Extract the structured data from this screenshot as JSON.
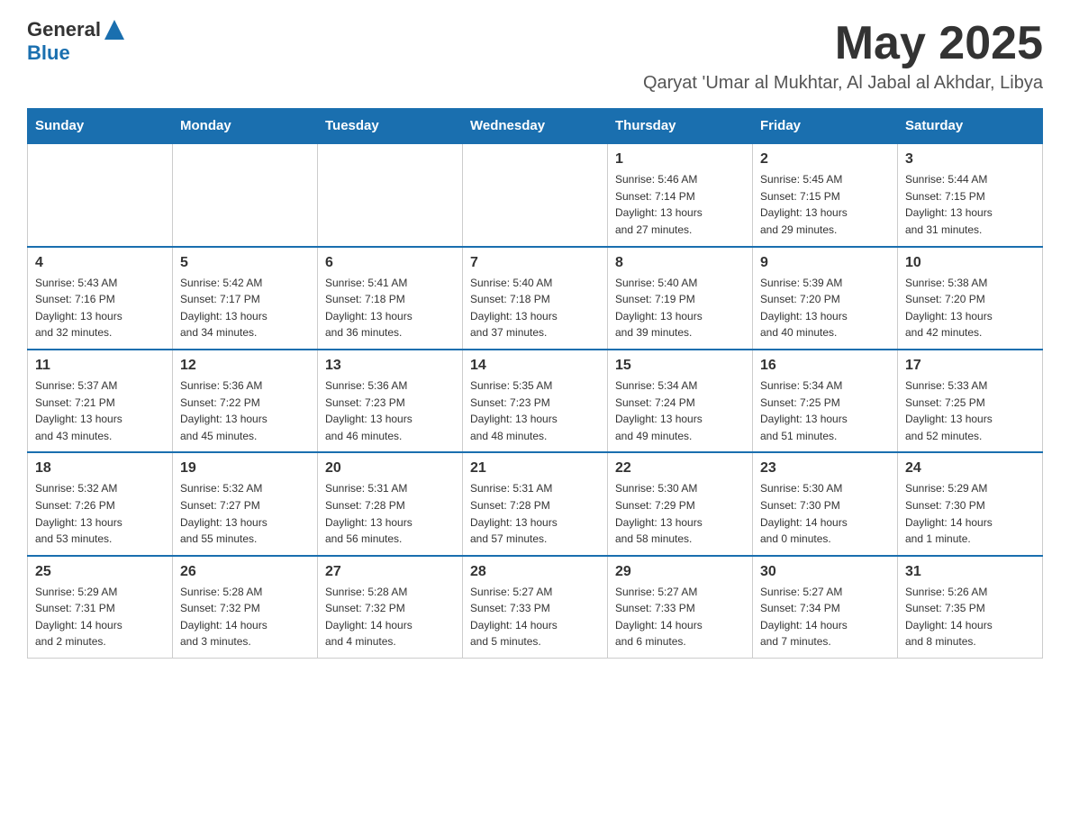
{
  "header": {
    "logo": {
      "text1": "General",
      "text2": "Blue"
    },
    "month": "May 2025",
    "location": "Qaryat 'Umar al Mukhtar, Al Jabal al Akhdar, Libya"
  },
  "days_of_week": [
    "Sunday",
    "Monday",
    "Tuesday",
    "Wednesday",
    "Thursday",
    "Friday",
    "Saturday"
  ],
  "weeks": [
    {
      "days": [
        {
          "number": "",
          "info": ""
        },
        {
          "number": "",
          "info": ""
        },
        {
          "number": "",
          "info": ""
        },
        {
          "number": "",
          "info": ""
        },
        {
          "number": "1",
          "info": "Sunrise: 5:46 AM\nSunset: 7:14 PM\nDaylight: 13 hours\nand 27 minutes."
        },
        {
          "number": "2",
          "info": "Sunrise: 5:45 AM\nSunset: 7:15 PM\nDaylight: 13 hours\nand 29 minutes."
        },
        {
          "number": "3",
          "info": "Sunrise: 5:44 AM\nSunset: 7:15 PM\nDaylight: 13 hours\nand 31 minutes."
        }
      ]
    },
    {
      "days": [
        {
          "number": "4",
          "info": "Sunrise: 5:43 AM\nSunset: 7:16 PM\nDaylight: 13 hours\nand 32 minutes."
        },
        {
          "number": "5",
          "info": "Sunrise: 5:42 AM\nSunset: 7:17 PM\nDaylight: 13 hours\nand 34 minutes."
        },
        {
          "number": "6",
          "info": "Sunrise: 5:41 AM\nSunset: 7:18 PM\nDaylight: 13 hours\nand 36 minutes."
        },
        {
          "number": "7",
          "info": "Sunrise: 5:40 AM\nSunset: 7:18 PM\nDaylight: 13 hours\nand 37 minutes."
        },
        {
          "number": "8",
          "info": "Sunrise: 5:40 AM\nSunset: 7:19 PM\nDaylight: 13 hours\nand 39 minutes."
        },
        {
          "number": "9",
          "info": "Sunrise: 5:39 AM\nSunset: 7:20 PM\nDaylight: 13 hours\nand 40 minutes."
        },
        {
          "number": "10",
          "info": "Sunrise: 5:38 AM\nSunset: 7:20 PM\nDaylight: 13 hours\nand 42 minutes."
        }
      ]
    },
    {
      "days": [
        {
          "number": "11",
          "info": "Sunrise: 5:37 AM\nSunset: 7:21 PM\nDaylight: 13 hours\nand 43 minutes."
        },
        {
          "number": "12",
          "info": "Sunrise: 5:36 AM\nSunset: 7:22 PM\nDaylight: 13 hours\nand 45 minutes."
        },
        {
          "number": "13",
          "info": "Sunrise: 5:36 AM\nSunset: 7:23 PM\nDaylight: 13 hours\nand 46 minutes."
        },
        {
          "number": "14",
          "info": "Sunrise: 5:35 AM\nSunset: 7:23 PM\nDaylight: 13 hours\nand 48 minutes."
        },
        {
          "number": "15",
          "info": "Sunrise: 5:34 AM\nSunset: 7:24 PM\nDaylight: 13 hours\nand 49 minutes."
        },
        {
          "number": "16",
          "info": "Sunrise: 5:34 AM\nSunset: 7:25 PM\nDaylight: 13 hours\nand 51 minutes."
        },
        {
          "number": "17",
          "info": "Sunrise: 5:33 AM\nSunset: 7:25 PM\nDaylight: 13 hours\nand 52 minutes."
        }
      ]
    },
    {
      "days": [
        {
          "number": "18",
          "info": "Sunrise: 5:32 AM\nSunset: 7:26 PM\nDaylight: 13 hours\nand 53 minutes."
        },
        {
          "number": "19",
          "info": "Sunrise: 5:32 AM\nSunset: 7:27 PM\nDaylight: 13 hours\nand 55 minutes."
        },
        {
          "number": "20",
          "info": "Sunrise: 5:31 AM\nSunset: 7:28 PM\nDaylight: 13 hours\nand 56 minutes."
        },
        {
          "number": "21",
          "info": "Sunrise: 5:31 AM\nSunset: 7:28 PM\nDaylight: 13 hours\nand 57 minutes."
        },
        {
          "number": "22",
          "info": "Sunrise: 5:30 AM\nSunset: 7:29 PM\nDaylight: 13 hours\nand 58 minutes."
        },
        {
          "number": "23",
          "info": "Sunrise: 5:30 AM\nSunset: 7:30 PM\nDaylight: 14 hours\nand 0 minutes."
        },
        {
          "number": "24",
          "info": "Sunrise: 5:29 AM\nSunset: 7:30 PM\nDaylight: 14 hours\nand 1 minute."
        }
      ]
    },
    {
      "days": [
        {
          "number": "25",
          "info": "Sunrise: 5:29 AM\nSunset: 7:31 PM\nDaylight: 14 hours\nand 2 minutes."
        },
        {
          "number": "26",
          "info": "Sunrise: 5:28 AM\nSunset: 7:32 PM\nDaylight: 14 hours\nand 3 minutes."
        },
        {
          "number": "27",
          "info": "Sunrise: 5:28 AM\nSunset: 7:32 PM\nDaylight: 14 hours\nand 4 minutes."
        },
        {
          "number": "28",
          "info": "Sunrise: 5:27 AM\nSunset: 7:33 PM\nDaylight: 14 hours\nand 5 minutes."
        },
        {
          "number": "29",
          "info": "Sunrise: 5:27 AM\nSunset: 7:33 PM\nDaylight: 14 hours\nand 6 minutes."
        },
        {
          "number": "30",
          "info": "Sunrise: 5:27 AM\nSunset: 7:34 PM\nDaylight: 14 hours\nand 7 minutes."
        },
        {
          "number": "31",
          "info": "Sunrise: 5:26 AM\nSunset: 7:35 PM\nDaylight: 14 hours\nand 8 minutes."
        }
      ]
    }
  ]
}
